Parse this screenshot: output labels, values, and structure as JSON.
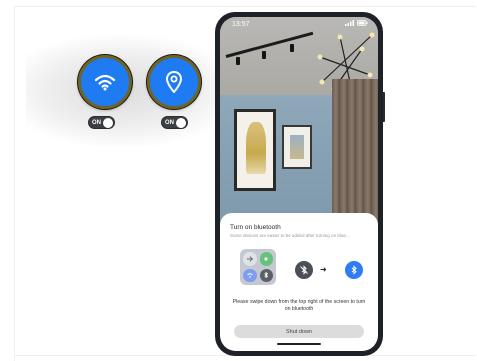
{
  "toggles": {
    "wifi_label": "ON",
    "location_label": "ON"
  },
  "phone": {
    "clock": "13:57"
  },
  "sheet": {
    "title": "Turn on bluetooth",
    "subtitle": "Some devices are easier to be added after turning on blue...",
    "instruction": "Please swipe down from the top right of the screen to turn on bluetooth",
    "shut_button": "Shut down"
  },
  "icons": {
    "wifi": "wifi-icon",
    "location": "location-pin-icon",
    "bt_off": "bluetooth-off-icon",
    "bt_on": "bluetooth-icon",
    "arrow": "arrow-right-icon"
  },
  "colors": {
    "accent_blue": "#1f7bf2",
    "ring_gold": "#6f6428",
    "toggle_dark": "#3c3f44",
    "bt_on_blue": "#2f7cf4"
  }
}
